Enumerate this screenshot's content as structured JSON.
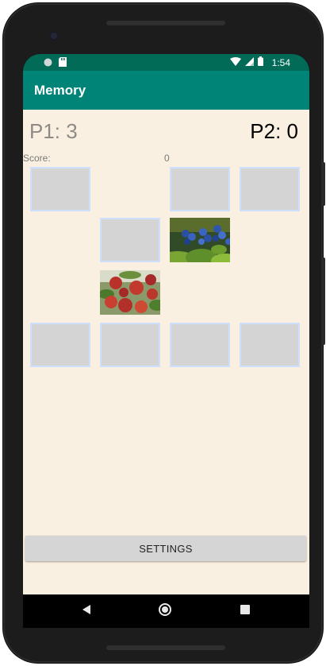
{
  "status_bar": {
    "time": "1:54",
    "icons": [
      "circle-icon",
      "sd-card-icon",
      "wifi-icon",
      "signal-icon",
      "battery-icon"
    ]
  },
  "app_bar": {
    "title": "Memory"
  },
  "players": {
    "p1": "P1: 3",
    "p2": "P2: 0"
  },
  "score": {
    "label": "Score:",
    "value": "0"
  },
  "board": {
    "rows": [
      [
        "hidden",
        "empty",
        "hidden",
        "hidden"
      ],
      [
        "empty",
        "hidden",
        "blueberries",
        "empty"
      ],
      [
        "empty",
        "apples",
        "empty",
        "empty"
      ],
      [
        "hidden",
        "hidden",
        "hidden",
        "hidden"
      ]
    ]
  },
  "buttons": {
    "settings": "SETTINGS"
  },
  "nav": {
    "icons": [
      "back-icon",
      "home-icon",
      "recents-icon"
    ]
  },
  "colors": {
    "status_bar": "#016b57",
    "app_bar": "#008477",
    "background": "#faf0e1",
    "card": "#d4d4d4",
    "card_border": "#cfe0ff"
  }
}
